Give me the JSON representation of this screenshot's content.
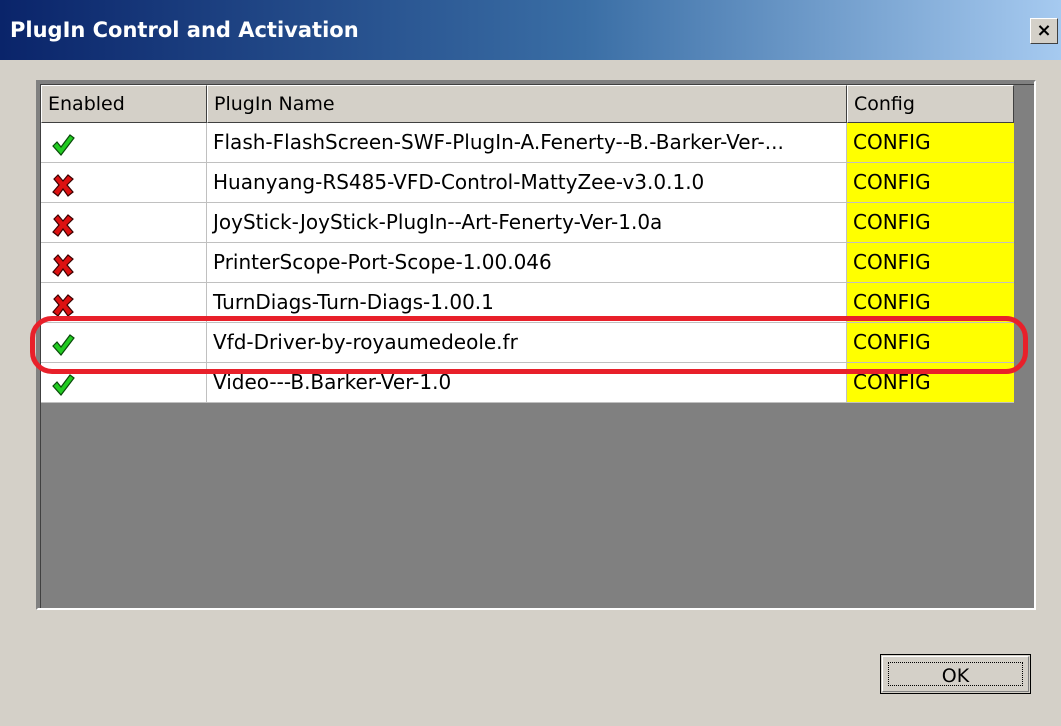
{
  "window": {
    "title": "PlugIn Control and Activation",
    "close_glyph": "×"
  },
  "table": {
    "columns": [
      "Enabled",
      "PlugIn Name",
      "Config"
    ],
    "rows": [
      {
        "enabled": true,
        "icon": "check-icon",
        "name": "Flash-FlashScreen-SWF-PlugIn-A.Fenerty--B.-Barker-Ver-...",
        "config": "CONFIG"
      },
      {
        "enabled": false,
        "icon": "cross-icon",
        "name": "Huanyang-RS485-VFD-Control-MattyZee-v3.0.1.0",
        "config": "CONFIG"
      },
      {
        "enabled": false,
        "icon": "cross-icon",
        "name": "JoyStick-JoyStick-PlugIn--Art-Fenerty-Ver-1.0a",
        "config": "CONFIG"
      },
      {
        "enabled": false,
        "icon": "cross-icon",
        "name": "PrinterScope-Port-Scope-1.00.046",
        "config": "CONFIG"
      },
      {
        "enabled": false,
        "icon": "cross-icon",
        "name": "TurnDiags-Turn-Diags-1.00.1",
        "config": "CONFIG"
      },
      {
        "enabled": true,
        "icon": "check-icon",
        "name": "Vfd-Driver-by-royaumedeole.fr",
        "config": "CONFIG"
      },
      {
        "enabled": true,
        "icon": "check-icon",
        "name": "Video---B.Barker-Ver-1.0",
        "config": "CONFIG"
      }
    ]
  },
  "ok_label": "OK",
  "colors": {
    "config_cell": "#ffff00",
    "check": "#22cc22",
    "cross": "#dd1111",
    "highlight": "#e8202a"
  }
}
